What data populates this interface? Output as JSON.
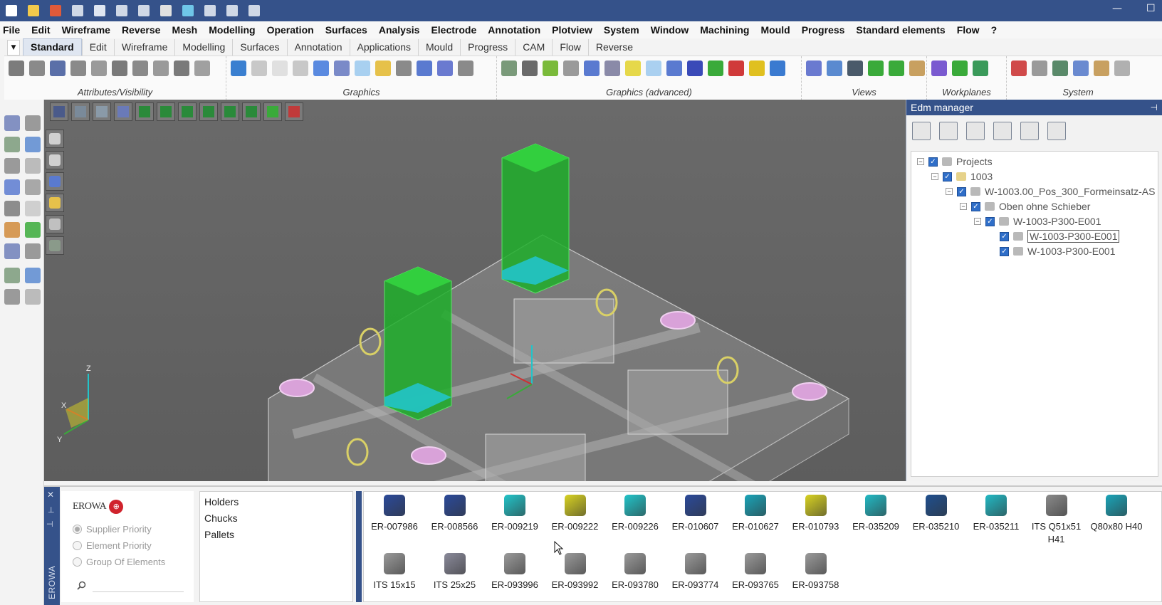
{
  "colors": {
    "titlebar": "#35528a",
    "accent": "#2f6ec8",
    "green_solid": "#1fae2a",
    "cyan_part": "#22c4c9",
    "pink_ring": "#d9a2d9",
    "erowa_red": "#d0232c"
  },
  "quick_access": [
    "new-file-icon",
    "open-folder-icon",
    "close-icon",
    "import-icon",
    "save-icon",
    "save-as-icon",
    "export-icon",
    "print-icon",
    "zoom-icon",
    "undo-icon",
    "redo-icon",
    "redo-list-icon"
  ],
  "menubar": [
    "File",
    "Edit",
    "Wireframe",
    "Reverse",
    "Mesh",
    "Modelling",
    "Operation",
    "Surfaces",
    "Analysis",
    "Electrode",
    "Annotation",
    "Plotview",
    "System",
    "Window",
    "Machining",
    "Mould",
    "Progress",
    "Standard elements",
    "Flow",
    "?"
  ],
  "ribbon_tabs": [
    "Standard",
    "Edit",
    "Wireframe",
    "Modelling",
    "Surfaces",
    "Annotation",
    "Applications",
    "Mould",
    "Progress",
    "CAM",
    "Flow",
    "Reverse"
  ],
  "ribbon_groups": [
    {
      "label": "Attributes/Visibility"
    },
    {
      "label": "Graphics"
    },
    {
      "label": "Graphics (advanced)"
    },
    {
      "label": "Views"
    },
    {
      "label": "Workplanes"
    },
    {
      "label": "System"
    }
  ],
  "edm": {
    "title": "Edm manager",
    "tree": [
      {
        "label": "Projects"
      },
      {
        "label": "1003"
      },
      {
        "label": "W-1003.00_Pos_300_Formeinsatz-AS"
      },
      {
        "label": "Oben ohne Schieber"
      },
      {
        "label": "W-1003-P300-E001"
      },
      {
        "label": "W-1003-P300-E001"
      },
      {
        "label": "W-1003-P300-E001"
      }
    ]
  },
  "bottom": {
    "vertical_label": "EROWA",
    "logo_text": "EROWA",
    "radios": [
      {
        "label": "Supplier Priority",
        "checked": true
      },
      {
        "label": "Element Priority",
        "checked": false
      },
      {
        "label": "Group Of Elements",
        "checked": false
      }
    ],
    "search_placeholder": "",
    "categories": [
      "Holders",
      "Chucks",
      "Pallets"
    ],
    "items": [
      {
        "label": "ER-007986",
        "color": "#2b4a9a"
      },
      {
        "label": "ER-008566",
        "color": "#2b4a9a"
      },
      {
        "label": "ER-009219",
        "color": "#22c4c9"
      },
      {
        "label": "ER-009222",
        "color": "#d8d222"
      },
      {
        "label": "ER-009226",
        "color": "#22c4c9"
      },
      {
        "label": "ER-010607",
        "color": "#2b4a9a"
      },
      {
        "label": "ER-010627",
        "color": "#1aa4b8"
      },
      {
        "label": "ER-010793",
        "color": "#d8d222"
      },
      {
        "label": "ER-035209",
        "color": "#22b9c4"
      },
      {
        "label": "ER-035210",
        "color": "#1f4f8e"
      },
      {
        "label": "ER-035211",
        "color": "#22b9c4"
      },
      {
        "label": "ITS Q51x51 H41",
        "color": "#8a8a8a"
      },
      {
        "label": "Q80x80 H40",
        "color": "#1aa4b8"
      },
      {
        "label": "ITS 15x15",
        "color": "#9a9a9a"
      },
      {
        "label": "ITS 25x25",
        "color": "#8a8a9a"
      },
      {
        "label": "ER-093996",
        "color": "#9a9a9a"
      },
      {
        "label": "ER-093992",
        "color": "#9a9a9a"
      },
      {
        "label": "ER-093780",
        "color": "#9a9a9a"
      },
      {
        "label": "ER-093774",
        "color": "#9a9a9a"
      },
      {
        "label": "ER-093765",
        "color": "#9a9a9a"
      },
      {
        "label": "ER-093758",
        "color": "#9a9a9a"
      }
    ]
  },
  "axis_labels": {
    "x": "X",
    "y": "Y",
    "z": "Z"
  }
}
